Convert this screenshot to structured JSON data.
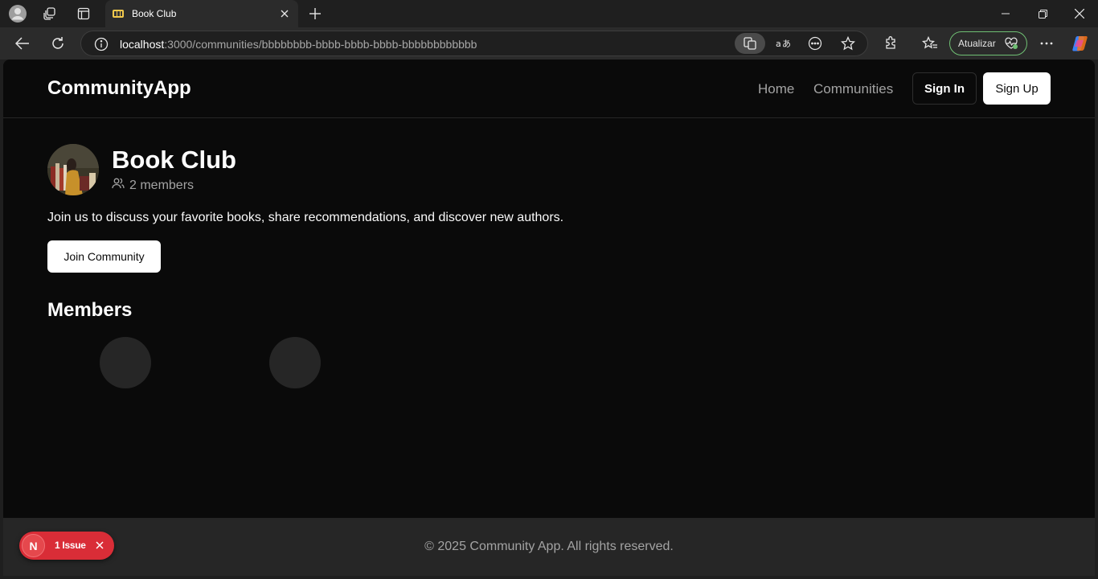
{
  "browser": {
    "tab_title": "Book Club",
    "url_host": "localhost",
    "url_path": ":3000/communities/bbbbbbbb-bbbb-bbbb-bbbb-bbbbbbbbbbbb",
    "update_label": "Atualizar",
    "accent_color": "#6fbf73"
  },
  "site": {
    "brand": "CommunityApp",
    "nav": {
      "home": "Home",
      "communities": "Communities",
      "sign_in": "Sign In",
      "sign_up": "Sign Up"
    }
  },
  "community": {
    "title": "Book Club",
    "member_count": "2 members",
    "description": "Join us to discuss your favorite books, share recommendations, and discover new authors.",
    "join_label": "Join Community",
    "members_heading": "Members",
    "members": [
      {
        "avatar": "placeholder"
      },
      {
        "avatar": "placeholder"
      }
    ]
  },
  "footer": {
    "text": "© 2025 Community App. All rights reserved."
  },
  "dev_overlay": {
    "logo_letter": "N",
    "issue_label": "1 Issue",
    "color": "#d92d37"
  }
}
